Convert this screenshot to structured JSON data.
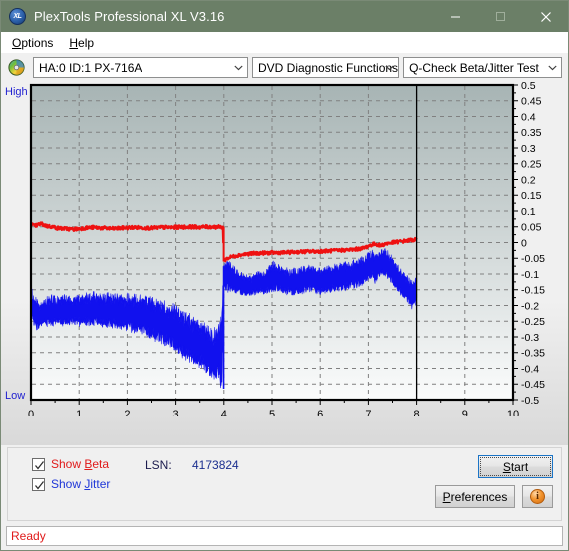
{
  "window": {
    "title": "PlexTools Professional XL V3.16",
    "icon": "xl-app-icon",
    "icon_text": "XL",
    "titlebar_color": "#6b7f67",
    "controls": [
      {
        "name": "minimize-button",
        "glyph": "minimize-icon"
      },
      {
        "name": "maximize-button",
        "glyph": "maximize-icon"
      },
      {
        "name": "close-button",
        "glyph": "close-icon"
      }
    ]
  },
  "menubar": {
    "items": [
      {
        "label": "Options",
        "accel": "O"
      },
      {
        "label": "Help",
        "accel": "H"
      }
    ]
  },
  "toolbar": {
    "disc_icon": "optical-disc-icon",
    "drive": {
      "value": "HA:0 ID:1  PX-716A",
      "options": [
        "HA:0 ID:1  PX-716A"
      ]
    },
    "function": {
      "value": "DVD Diagnostic Functions",
      "options": [
        "DVD Diagnostic Functions"
      ]
    },
    "test": {
      "value": "Q-Check Beta/Jitter Test",
      "options": [
        "Q-Check Beta/Jitter Test"
      ]
    }
  },
  "chart_data": {
    "type": "line",
    "title": "",
    "xlabel": "",
    "ylabel": "",
    "left_axis_labels": {
      "top": "High",
      "bottom": "Low"
    },
    "xlim": [
      0,
      10
    ],
    "ylim": [
      -0.5,
      0.5
    ],
    "x_ticks": [
      0,
      1,
      2,
      3,
      4,
      5,
      6,
      7,
      8,
      9,
      10
    ],
    "y_ticks": [
      0.5,
      0.45,
      0.4,
      0.35,
      0.3,
      0.25,
      0.2,
      0.15,
      0.1,
      0.05,
      0,
      -0.05,
      -0.1,
      -0.15,
      -0.2,
      -0.25,
      -0.3,
      -0.35,
      -0.4,
      -0.45,
      -0.5
    ],
    "grid": true,
    "grid_style": "dashed",
    "legend_position": "bottom-left-checkboxes",
    "plot_background_gradient": [
      "#a7b4b4",
      "#fbfcfc"
    ],
    "data_end_marker_x": 8,
    "series": [
      {
        "name": "Beta",
        "color": "#ee1111",
        "x": [
          0.0,
          0.07,
          0.14,
          0.21,
          0.28,
          0.35,
          0.45,
          0.55,
          0.7,
          0.9,
          1.1,
          1.3,
          1.5,
          1.7,
          1.9,
          2.1,
          2.3,
          2.5,
          2.7,
          2.9,
          3.1,
          3.3,
          3.5,
          3.7,
          3.9,
          3.98,
          4.0,
          4.05,
          4.15,
          4.3,
          4.5,
          4.7,
          4.9,
          5.1,
          5.3,
          5.5,
          5.7,
          5.9,
          6.1,
          6.3,
          6.5,
          6.7,
          6.9,
          7.05,
          7.15,
          7.25,
          7.35,
          7.5,
          7.7,
          7.9,
          8.0
        ],
        "y": [
          0.06,
          0.052,
          0.056,
          0.06,
          0.055,
          0.052,
          0.05,
          0.046,
          0.044,
          0.042,
          0.046,
          0.048,
          0.046,
          0.044,
          0.046,
          0.048,
          0.047,
          0.046,
          0.048,
          0.048,
          0.049,
          0.05,
          0.049,
          0.05,
          0.049,
          0.049,
          -0.058,
          -0.052,
          -0.046,
          -0.04,
          -0.036,
          -0.034,
          -0.033,
          -0.032,
          -0.032,
          -0.03,
          -0.029,
          -0.028,
          -0.027,
          -0.026,
          -0.024,
          -0.022,
          -0.018,
          -0.008,
          -0.004,
          -0.01,
          -0.004,
          0.0,
          0.004,
          0.008,
          0.01
        ]
      },
      {
        "name": "Jitter",
        "color": "#1111ee",
        "band": true,
        "x": [
          0.0,
          0.06,
          0.12,
          0.2,
          0.3,
          0.42,
          0.55,
          0.7,
          0.85,
          1.0,
          1.15,
          1.3,
          1.45,
          1.6,
          1.75,
          1.9,
          2.05,
          2.2,
          2.35,
          2.5,
          2.65,
          2.8,
          2.95,
          3.1,
          3.25,
          3.4,
          3.55,
          3.7,
          3.82,
          3.9,
          3.96,
          4.0,
          4.06,
          4.14,
          4.25,
          4.4,
          4.55,
          4.7,
          4.85,
          5.0,
          5.12,
          5.24,
          5.4,
          5.55,
          5.7,
          5.85,
          6.0,
          6.15,
          6.3,
          6.45,
          6.6,
          6.75,
          6.9,
          7.0,
          7.08,
          7.14,
          7.22,
          7.3,
          7.38,
          7.46,
          7.55,
          7.65,
          7.78,
          7.9,
          7.98
        ],
        "y_top": [
          -0.14,
          -0.19,
          -0.2,
          -0.205,
          -0.195,
          -0.185,
          -0.19,
          -0.185,
          -0.19,
          -0.185,
          -0.18,
          -0.175,
          -0.185,
          -0.18,
          -0.185,
          -0.19,
          -0.185,
          -0.19,
          -0.195,
          -0.2,
          -0.21,
          -0.215,
          -0.225,
          -0.24,
          -0.255,
          -0.27,
          -0.28,
          -0.3,
          -0.31,
          -0.29,
          -0.27,
          -0.075,
          -0.078,
          -0.08,
          -0.1,
          -0.112,
          -0.118,
          -0.105,
          -0.108,
          -0.078,
          -0.082,
          -0.098,
          -0.1,
          -0.095,
          -0.09,
          -0.085,
          -0.098,
          -0.092,
          -0.086,
          -0.082,
          -0.08,
          -0.072,
          -0.062,
          -0.046,
          -0.04,
          -0.06,
          -0.044,
          -0.034,
          -0.04,
          -0.055,
          -0.075,
          -0.095,
          -0.118,
          -0.14,
          -0.13
        ],
        "y_bot": [
          -0.21,
          -0.255,
          -0.265,
          -0.255,
          -0.25,
          -0.25,
          -0.248,
          -0.25,
          -0.245,
          -0.248,
          -0.25,
          -0.245,
          -0.25,
          -0.255,
          -0.252,
          -0.258,
          -0.262,
          -0.268,
          -0.275,
          -0.285,
          -0.295,
          -0.305,
          -0.318,
          -0.335,
          -0.35,
          -0.365,
          -0.378,
          -0.4,
          -0.42,
          -0.4,
          -0.455,
          -0.135,
          -0.14,
          -0.142,
          -0.15,
          -0.158,
          -0.162,
          -0.152,
          -0.155,
          -0.14,
          -0.142,
          -0.15,
          -0.152,
          -0.15,
          -0.145,
          -0.142,
          -0.152,
          -0.148,
          -0.142,
          -0.138,
          -0.135,
          -0.13,
          -0.12,
          -0.105,
          -0.098,
          -0.115,
          -0.1,
          -0.09,
          -0.095,
          -0.11,
          -0.13,
          -0.15,
          -0.17,
          -0.195,
          -0.185
        ]
      }
    ]
  },
  "controls": {
    "show_beta": {
      "label_pre": "Show ",
      "label_accel": "B",
      "label_post": "eta",
      "checked": true,
      "color": "#e01b1b"
    },
    "show_jitter": {
      "label_pre": "Show ",
      "label_accel": "J",
      "label_post": "itter",
      "checked": true,
      "color": "#1f37d8"
    },
    "lsn_label": "LSN:",
    "lsn_value": "4173824",
    "start_button": {
      "pre": "",
      "accel": "S",
      "post": "tart",
      "focused": true
    },
    "preferences_button": {
      "pre": "",
      "accel": "P",
      "post": "references"
    },
    "info_button": {
      "glyph": "info-icon",
      "text": "i"
    }
  },
  "statusbar": {
    "text": "Ready",
    "color": "#e01b1b"
  }
}
